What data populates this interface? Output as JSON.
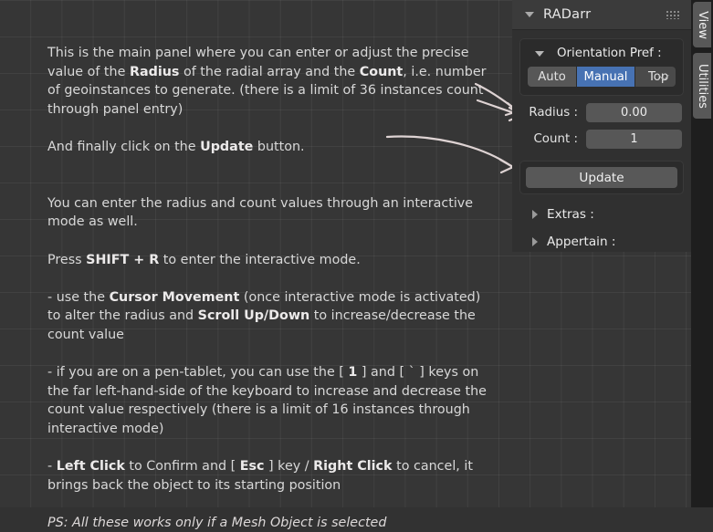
{
  "help_text": {
    "p1_a": "This is the main panel where you can enter or adjust the precise value of the ",
    "p1_b": "Radius",
    "p1_c": " of the radial array and the ",
    "p1_d": "Count",
    "p1_e": ", i.e. number of geoinstances to generate. (there is a limit of 36 instances count through panel entry)",
    "p2_a": "And finally click on the ",
    "p2_b": "Update",
    "p2_c": " button.",
    "p3": "You can enter the radius and count values through an interactive mode as well.",
    "p4_a": "Press ",
    "p4_b": "SHIFT + R",
    "p4_c": " to enter the interactive mode.",
    "p5_a": "- use the ",
    "p5_b": "Cursor Movement",
    "p5_c": " (once interactive mode is activated) to alter the radius and ",
    "p5_d": "Scroll Up/Down",
    "p5_e": " to increase/decrease the count value",
    "p6_a": "- if you are on a pen-tablet, you can use the [ ",
    "p6_b": "1",
    "p6_c": " ] and [ ` ] keys on the far left-hand-side of the keyboard to increase and decrease the count value respectively (there is a limit of 16 instances through interactive mode)",
    "p7_a": " - ",
    "p7_b": "Left Click",
    "p7_c": " to Confirm and [ ",
    "p7_d": "Esc",
    "p7_e": " ] key / ",
    "p7_f": "Right Click",
    "p7_g": " to cancel, it brings back the object to its starting position",
    "p8": "PS: All these works only if a Mesh Object is selected"
  },
  "panel": {
    "title": "RADarr",
    "collapse_icon": "triangle-down-icon",
    "grip_icon": "grip-dots-icon",
    "orientation": {
      "title": "Orientation Pref :",
      "collapse_icon": "triangle-down-icon",
      "options": [
        "Auto",
        "Manual"
      ],
      "selected": "Manual",
      "dropdown_value": "Top",
      "dropdown_icon": "chevron-down-icon",
      "accent_color": "#4772b3"
    },
    "fields": [
      {
        "label": "Radius :",
        "value": "0.00"
      },
      {
        "label": "Count :",
        "value": "1"
      }
    ],
    "update_label": "Update",
    "sections": [
      {
        "label": "Extras :",
        "icon": "triangle-right-icon"
      },
      {
        "label": "Appertain :",
        "icon": "triangle-right-icon"
      }
    ]
  },
  "vertical_tabs": [
    {
      "label": "View"
    },
    {
      "label": "Utilities"
    }
  ],
  "annotations": {
    "arrow_targets": [
      "radius-field",
      "count-field",
      "update-button"
    ],
    "arrow_color": "#ded3d3"
  }
}
